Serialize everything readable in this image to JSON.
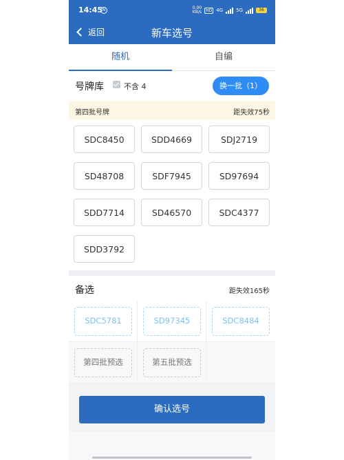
{
  "status": {
    "time": "14:45",
    "dnd": "N",
    "speed_top": "0.00",
    "speed_bottom": "KB/s",
    "net1": "HD",
    "net2": "4G",
    "net3": "5G",
    "battery": "36"
  },
  "nav": {
    "back_label": "返回",
    "title": "新车选号"
  },
  "tabs": [
    {
      "label": "随机",
      "active": true
    },
    {
      "label": "自编",
      "active": false
    }
  ],
  "pool": {
    "title": "号牌库",
    "exclude_label": "不含 4",
    "exclude_checked": true,
    "swap_button": "换一批（1）"
  },
  "batch": {
    "label": "第四批号牌",
    "expire": "距失效75秒"
  },
  "plates": [
    "SDC8450",
    "SDD4669",
    "SDJ2719",
    "SD48708",
    "SDF7945",
    "SD97694",
    "SDD7714",
    "SD46570",
    "SDC4377",
    "SDD3792"
  ],
  "alternates": {
    "title": "备选",
    "expire": "距失效165秒",
    "chips": [
      "SDC5781",
      "SD97345",
      "SDC8484"
    ],
    "preselect": [
      "第四批预选",
      "第五批预选"
    ]
  },
  "confirm_button": "确认选号",
  "colors": {
    "primary": "#2b6cc0",
    "accent": "#2f8cf4",
    "banner": "#fdf6e4",
    "alt_chip": "#7cc3ee"
  }
}
